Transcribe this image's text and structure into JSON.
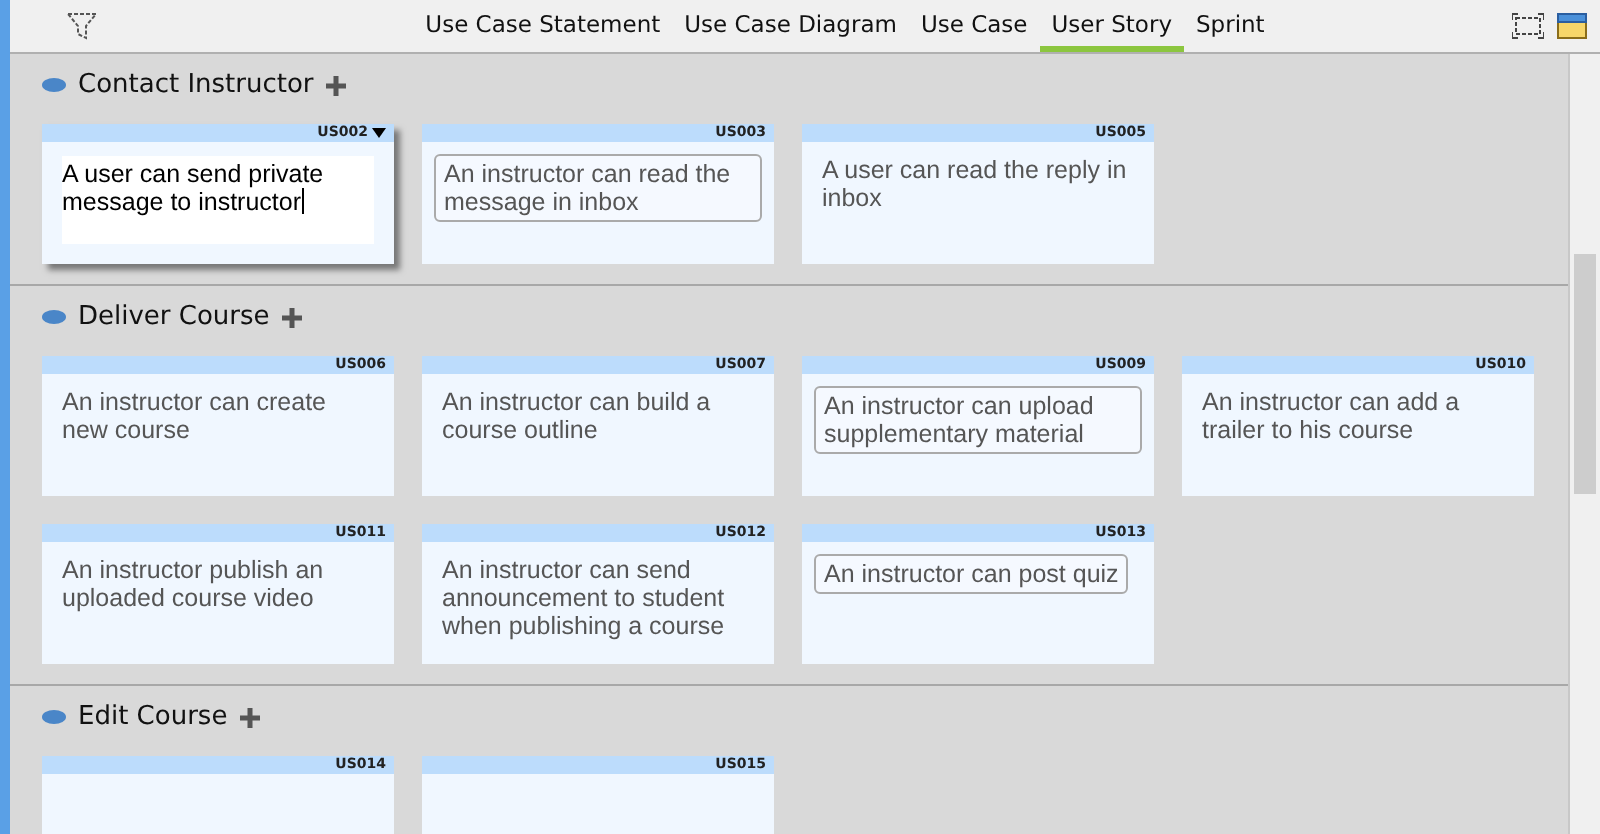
{
  "tabs": [
    {
      "label": "Use Case Statement",
      "selected": false
    },
    {
      "label": "Use Case Diagram",
      "selected": false
    },
    {
      "label": "Use Case",
      "selected": false
    },
    {
      "label": "User Story",
      "selected": true
    },
    {
      "label": "Sprint",
      "selected": false
    }
  ],
  "sections": [
    {
      "title": "Contact Instructor",
      "cards": [
        {
          "id": "US002",
          "kind": "editing",
          "text": "A user can send private message to instructor"
        },
        {
          "id": "US003",
          "kind": "framed",
          "text": "An instructor can read the message in inbox"
        },
        {
          "id": "US005",
          "kind": "plain",
          "text": "A user can read the reply in inbox"
        }
      ]
    },
    {
      "title": "Deliver Course",
      "cards": [
        {
          "id": "US006",
          "kind": "plain",
          "text": "An instructor can create new course"
        },
        {
          "id": "US007",
          "kind": "plain",
          "text": "An instructor can build a course outline"
        },
        {
          "id": "US009",
          "kind": "framed",
          "text": "An instructor can upload supplementary material"
        },
        {
          "id": "US010",
          "kind": "plain",
          "text": "An instructor can add a trailer to his course"
        },
        {
          "id": "US011",
          "kind": "plain",
          "text": "An instructor publish an uploaded course video"
        },
        {
          "id": "US012",
          "kind": "plain",
          "text": "An instructor can send announcement to student when publishing a course"
        },
        {
          "id": "US013",
          "kind": "framed",
          "text": "An instructor can post quiz"
        }
      ]
    },
    {
      "title": "Edit Course",
      "cards": [
        {
          "id": "US014",
          "kind": "plain"
        },
        {
          "id": "US015",
          "kind": "plain"
        }
      ]
    }
  ]
}
